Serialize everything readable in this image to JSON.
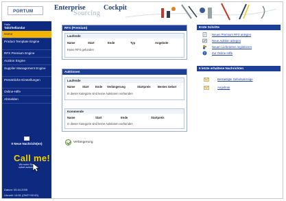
{
  "header": {
    "logo": "PORTUM",
    "title_word1": "Enterprise",
    "title_word2": "Cockpit",
    "title_sub": "Sourcing"
  },
  "sidebar": {
    "user_label": "Hallo",
    "user_name": "Tabirhellandar",
    "items": [
      {
        "label": "Home",
        "active": true
      },
      {
        "label": "Product Template Engine"
      },
      {
        "label": "RFX Premium Engine"
      },
      {
        "label": "Auction Engine"
      },
      {
        "label": "Supplier Management Engine"
      },
      {
        "label": "Persönliche Einstellungen"
      },
      {
        "label": "Online-Hilfe"
      },
      {
        "label": "Abmelden"
      }
    ],
    "messages": "0 Neue Nachricht(en)",
    "callme_title": "Call me!",
    "callme_text": "Wir rufen Sie sofort zurück!",
    "date_line": "Datum: 05.04.2005",
    "time_line": "Uhrzeit: 14:51 (GMT+02:00)"
  },
  "rfx": {
    "title": "RFX (Premium)",
    "sub_title": "Laufende",
    "columns": [
      "Name",
      "Start",
      "Ende",
      "Typ",
      "Angebote"
    ],
    "empty": "Keine RFX gefunden"
  },
  "auctions": {
    "title": "Auktionen",
    "running": {
      "title": "Laufende",
      "columns": [
        "Name",
        "Start",
        "Ende",
        "Verlängerung",
        "Startpreis",
        "Bestes Gebot"
      ],
      "empty": "In dieser Kategorie sind keine Auktionen vorhanden"
    },
    "upcoming": {
      "title": "Kommende",
      "columns": [
        "Name",
        "Start",
        "Ende",
        "Startpreis"
      ],
      "empty": "In dieser Kategorie sind keine Auktionen vorhanden"
    }
  },
  "extend_button": "Verlängerung",
  "first_steps": {
    "title": "Erste Schritte",
    "links": [
      {
        "label": "Neues Premium RFX anlegen",
        "icon": "document-icon"
      },
      {
        "label": "Neue Auktion anlegen",
        "icon": "auction-icon"
      },
      {
        "label": "Neuen Lieferanten registrieren",
        "icon": "supplier-icon"
      },
      {
        "label": "Zur Online-Hilfe",
        "icon": "help-icon"
      }
    ]
  },
  "recent_messages": {
    "title": "5 letzte erhaltene Nachrichten",
    "links": [
      {
        "label": "Bestaetigte Gebotsanzeige",
        "icon": "message-icon"
      },
      {
        "label": "Angebote",
        "icon": "message-icon"
      }
    ]
  },
  "colors": {
    "navy": "#0d2a80",
    "panel_header": "#1d3f97",
    "active_yellow": "#f3b400",
    "link_blue": "#2142a8"
  }
}
